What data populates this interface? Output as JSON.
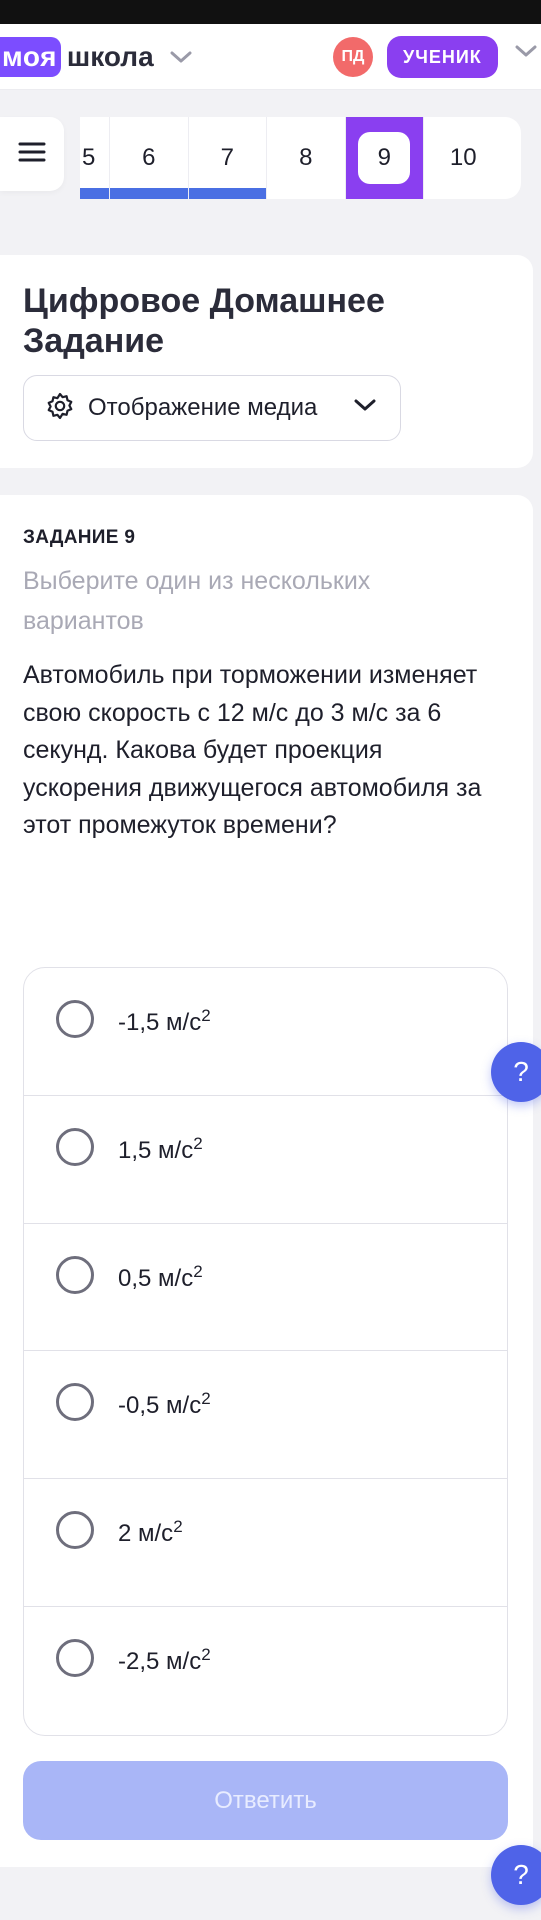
{
  "header": {
    "logo_part1": "моя",
    "logo_part2": "школа",
    "avatar_initials": "ПД",
    "role_label": "УЧЕНИК"
  },
  "nav": {
    "tabs": [
      {
        "label": "5",
        "state": "done"
      },
      {
        "label": "6",
        "state": "done"
      },
      {
        "label": "7",
        "state": "done"
      },
      {
        "label": "8",
        "state": "default"
      },
      {
        "label": "9",
        "state": "active"
      },
      {
        "label": "10",
        "state": "default"
      }
    ]
  },
  "homework": {
    "title": "Цифровое Домашнее Задание",
    "media_button_label": "Отображение медиа"
  },
  "task": {
    "number_label": "ЗАДАНИЕ 9",
    "hint": "Выберите один из нескольких вариантов",
    "question": "Автомобиль при торможении изменяет свою скорость с 12 м/с до 3 м/с за 6 секунд. Какова будет проекция ускорения движущегося автомобиля за этот промежуток времени?",
    "options": [
      {
        "value": "-1,5 м/с",
        "exp": "2"
      },
      {
        "value": "1,5 м/с",
        "exp": "2"
      },
      {
        "value": "0,5 м/с",
        "exp": "2"
      },
      {
        "value": "-0,5 м/с",
        "exp": "2"
      },
      {
        "value": "2 м/с",
        "exp": "2"
      },
      {
        "value": "-2,5 м/с",
        "exp": "2"
      }
    ],
    "submit_label": "Ответить"
  },
  "help": {
    "label": "?"
  },
  "colors": {
    "brand_purple": "#8a3ff0",
    "progress_blue": "#4a6fe3",
    "submit_disabled": "#a9b6f7",
    "help_blue": "#4f63e8"
  }
}
